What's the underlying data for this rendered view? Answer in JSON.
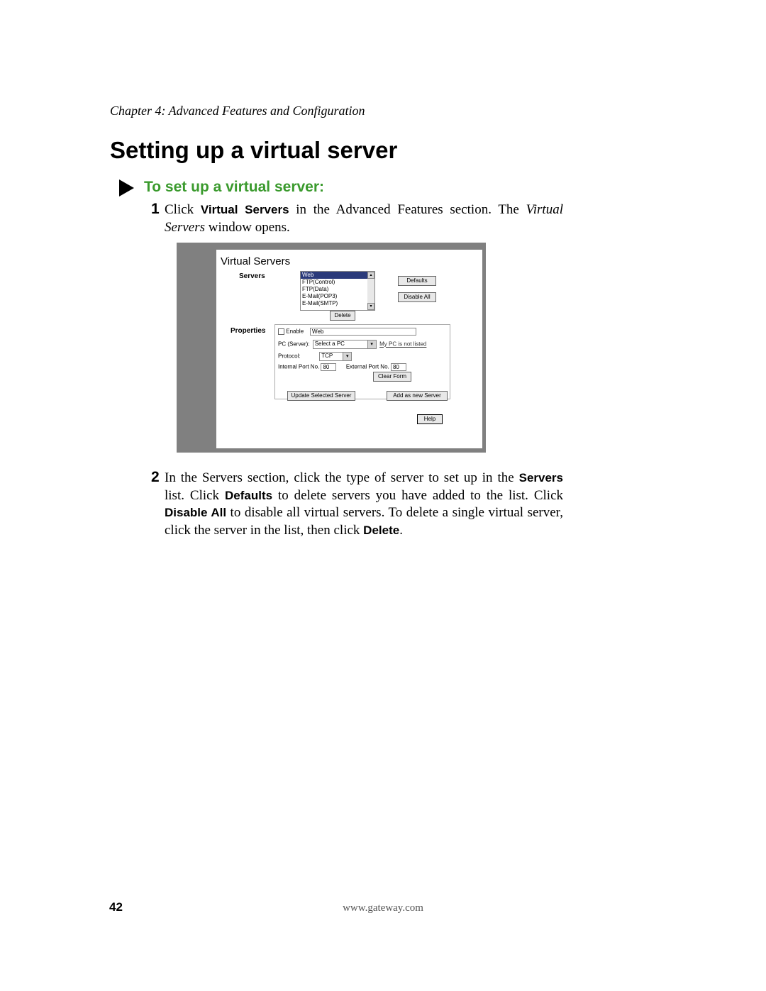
{
  "chapter": "Chapter 4: Advanced Features and Configuration",
  "section_title": "Setting up a virtual server",
  "sub_heading": "To set up a virtual server:",
  "step1": {
    "num": "1",
    "lead": "Click ",
    "bold1": "Virtual Servers",
    "mid1": " in the Advanced Features section. The ",
    "ital": "Virtual Servers",
    "tail": " window opens."
  },
  "screenshot": {
    "title": "Virtual Servers",
    "label_servers": "Servers",
    "server_list": [
      "Web",
      "FTP(Control)",
      "FTP(Data)",
      "E-Mail(POP3)",
      "E-Mail(SMTP)"
    ],
    "btn_defaults": "Defaults",
    "btn_disableall": "Disable All",
    "btn_delete": "Delete",
    "label_properties": "Properties",
    "enable_label": "Enable",
    "enable_value": "Web",
    "pc_label": "PC (Server):",
    "pc_value": "Select a PC",
    "pc_link": "My PC is not listed",
    "protocol_label": "Protocol:",
    "protocol_value": "TCP",
    "intport_label": "Internal Port No.",
    "intport_value": "80",
    "extport_label": "External Port No.",
    "extport_value": "80",
    "btn_clear": "Clear Form",
    "btn_update": "Update Selected Server",
    "btn_addnew": "Add as new Server",
    "btn_help": "Help"
  },
  "step2": {
    "num": "2",
    "p1a": "In the Servers section, click the type of server to set up in the ",
    "b1": "Servers",
    "p1b": " list. Click ",
    "b2": "Defaults",
    "p1c": " to delete servers you have added to the list. Click ",
    "b3": "Disable All",
    "p1d": " to disable all virtual servers. To delete a single virtual server, click the server in the list, then click ",
    "b4": "Delete",
    "p1e": "."
  },
  "page_number": "42",
  "footer_url": "www.gateway.com"
}
